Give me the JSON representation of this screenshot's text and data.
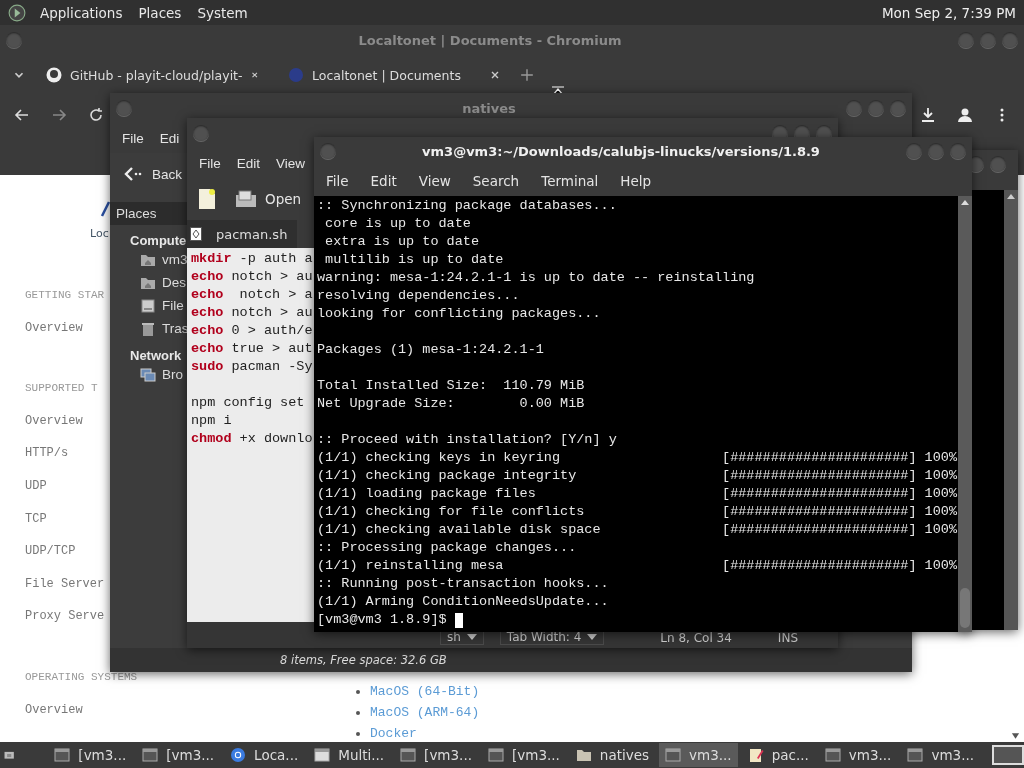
{
  "panel": {
    "menus": [
      "Applications",
      "Places",
      "System"
    ],
    "clock": "Mon Sep  2, 7:39 PM"
  },
  "browser": {
    "title": "Localtonet | Documents - Chromium",
    "tabs": [
      {
        "label": "GitHub - playit-cloud/playit-",
        "kind": "github"
      },
      {
        "label": "Localtonet | Documents",
        "kind": "site"
      }
    ],
    "logo_text": "Loc",
    "doc_nav": [
      {
        "text": "GETTING STAR",
        "kind": "heading"
      },
      {
        "text": "Overview",
        "kind": "link"
      },
      {
        "text": "SUPPORTED T",
        "kind": "heading"
      },
      {
        "text": "Overview",
        "kind": "link"
      },
      {
        "text": "HTTP/s",
        "kind": "link"
      },
      {
        "text": "UDP",
        "kind": "link"
      },
      {
        "text": "TCP",
        "kind": "link"
      },
      {
        "text": "UDP/TCP",
        "kind": "link"
      },
      {
        "text": "File Server",
        "kind": "link"
      },
      {
        "text": "Proxy Serve",
        "kind": "link"
      },
      {
        "text": "OPERATING SYSTEMS",
        "kind": "heading"
      },
      {
        "text": "Overview",
        "kind": "link"
      }
    ],
    "doc_list": [
      "MacOS (64-Bit)",
      "MacOS (ARM-64)",
      "Docker"
    ]
  },
  "file_manager": {
    "title": "natives",
    "menus": [
      "File",
      "Edi"
    ],
    "back": "Back",
    "places": "Places",
    "sections": [
      {
        "label": "Compute",
        "items": [
          {
            "label": "vm3",
            "kind": "home"
          },
          {
            "label": "Des",
            "kind": "desktop"
          },
          {
            "label": "File",
            "kind": "drive"
          },
          {
            "label": "Tras",
            "kind": "trash"
          }
        ]
      },
      {
        "label": "Network",
        "items": [
          {
            "label": "Bro",
            "kind": "network"
          }
        ]
      }
    ],
    "status": "8 items, Free space: 32.6 GB"
  },
  "editor": {
    "menus": [
      "File",
      "Edit",
      "View"
    ],
    "open": "Open",
    "tab": "pacman.sh",
    "blocks": [
      [
        {
          "kw": "mkdir",
          "rest": " -p auth a"
        },
        {
          "kw": "echo",
          "rest": " notch > au"
        },
        {
          "kw": "echo",
          "rest": "  notch > a"
        },
        {
          "kw": "echo",
          "rest": " notch > au"
        },
        {
          "kw": "echo",
          "rest": " 0 > auth/e"
        },
        {
          "kw": "echo",
          "rest": " true > aut"
        },
        {
          "kw": "sudo",
          "rest": " pacman -Sy"
        }
      ],
      [
        {
          "rest": "npm config set"
        },
        {
          "rest": "npm i"
        },
        {
          "kw": "chmod",
          "rest": " +x downlo"
        }
      ]
    ],
    "language": "sh",
    "tab_width": "Tab Width:  4",
    "position": "Ln 8, Col 34",
    "mode": "INS"
  },
  "terminal": {
    "title": "vm3@vm3:~/Downloads/calubjs-linucks/versions/1.8.9",
    "menus": [
      "File",
      "Edit",
      "View",
      "Search",
      "Terminal",
      "Help"
    ],
    "blocks": [
      [
        ":: Synchronizing package databases...",
        " core is up to date",
        " extra is up to date",
        " multilib is up to date",
        "warning: mesa-1:24.2.1-1 is up to date -- reinstalling",
        "resolving dependencies...",
        "looking for conflicting packages..."
      ],
      [
        "Packages (1) mesa-1:24.2.1-1"
      ],
      [
        "Total Installed Size:  110.79 MiB",
        "Net Upgrade Size:        0.00 MiB"
      ],
      [
        ":: Proceed with installation? [Y/n] y",
        "(1/1) checking keys in keyring                    [######################] 100%",
        "(1/1) checking package integrity                  [######################] 100%",
        "(1/1) loading package files                       [######################] 100%",
        "(1/1) checking for file conflicts                 [######################] 100%",
        "(1/1) checking available disk space               [######################] 100%",
        ":: Processing package changes...",
        "(1/1) reinstalling mesa                           [######################] 100%",
        ":: Running post-transaction hooks...",
        "(1/1) Arming ConditionNeedsUpdate..."
      ]
    ],
    "prompt": "[vm3@vm3 1.8.9]$"
  },
  "taskbar": [
    {
      "label": "[vm3...",
      "kind": "terminal",
      "selected": false
    },
    {
      "label": "[vm3...",
      "kind": "terminal",
      "selected": false
    },
    {
      "label": "Loca...",
      "kind": "browser",
      "selected": false
    },
    {
      "label": "Multi...",
      "kind": "window",
      "selected": false
    },
    {
      "label": "[vm3...",
      "kind": "terminal",
      "selected": false
    },
    {
      "label": "[vm3...",
      "kind": "terminal",
      "selected": false
    },
    {
      "label": "natives",
      "kind": "folder",
      "selected": false
    },
    {
      "label": "vm3...",
      "kind": "terminal",
      "selected": true
    },
    {
      "label": "pac...",
      "kind": "editor",
      "selected": false
    },
    {
      "label": "vm3...",
      "kind": "terminal",
      "selected": false
    },
    {
      "label": "vm3...",
      "kind": "terminal",
      "selected": false
    }
  ]
}
